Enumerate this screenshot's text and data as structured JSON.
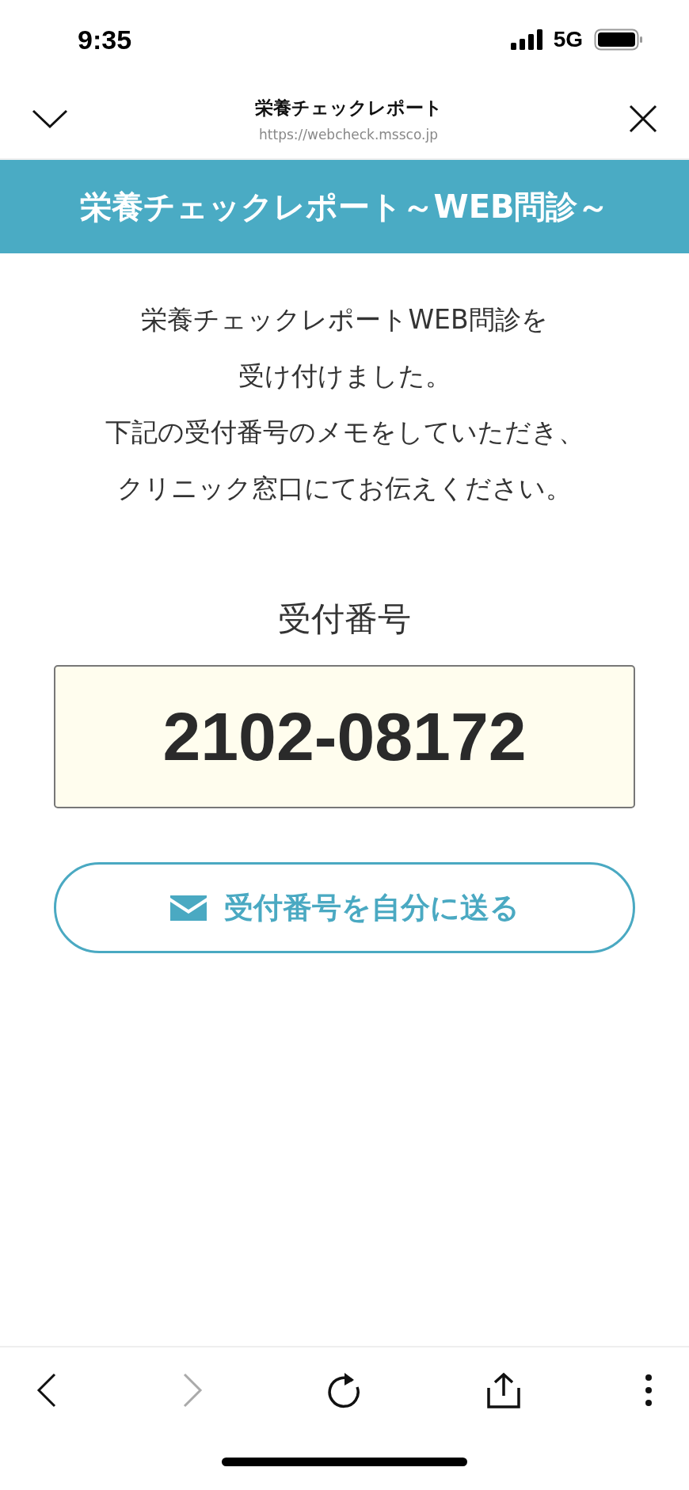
{
  "status_bar": {
    "time": "9:35",
    "network": "5G"
  },
  "browser_header": {
    "title": "栄養チェックレポート",
    "url": "https://webcheck.mssco.jp"
  },
  "banner": {
    "title": "栄養チェックレポート～WEB問診～"
  },
  "message": [
    "栄養チェックレポートWEB問診を",
    "受け付けました。",
    "下記の受付番号のメモをしていただき、",
    "クリニック窓口にてお伝えください。"
  ],
  "receipt": {
    "label": "受付番号",
    "number": "2102-08172"
  },
  "send_button": {
    "label": "受付番号を自分に送る"
  },
  "toolbar": [
    {
      "kind": "back",
      "disabled": false
    },
    {
      "kind": "forward",
      "disabled": true
    },
    {
      "kind": "reload",
      "disabled": false
    },
    {
      "kind": "share",
      "disabled": false
    },
    {
      "kind": "more",
      "disabled": false
    }
  ]
}
